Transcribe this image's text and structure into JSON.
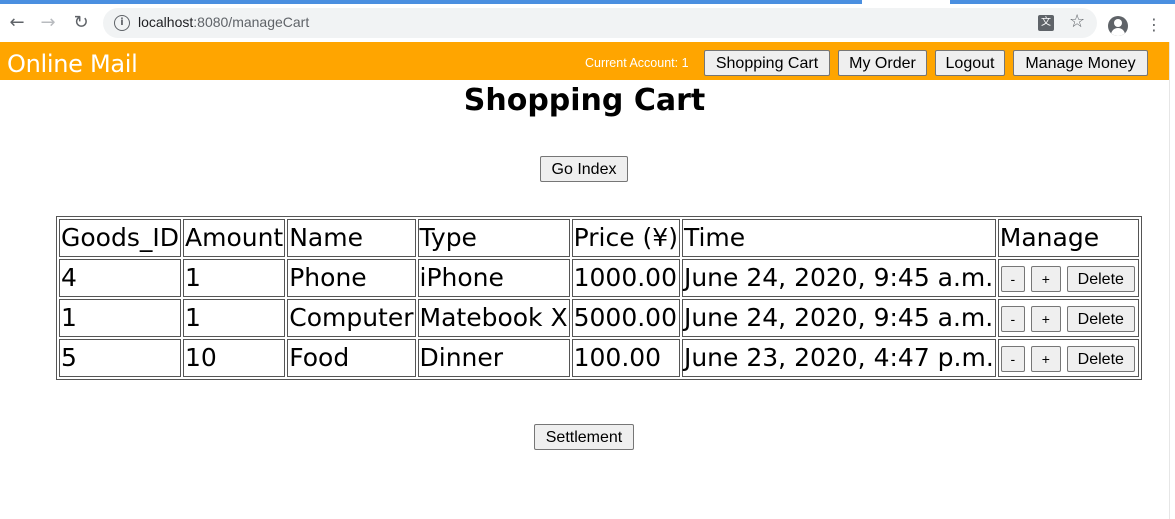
{
  "browser": {
    "url_host": "localhost",
    "url_path": ":8080/manageCart"
  },
  "header": {
    "site_title": "Online Mail",
    "account_text": "Current Account: 1",
    "nav_buttons": [
      "Shopping Cart",
      "My Order",
      "Logout",
      "Manage Money"
    ]
  },
  "main": {
    "page_title": "Shopping Cart",
    "go_index_label": "Go Index",
    "settlement_label": "Settlement",
    "table": {
      "headers": [
        "Goods_ID",
        "Amount",
        "Name",
        "Type",
        "Price (¥)",
        "Time",
        "Manage"
      ],
      "rows": [
        {
          "goods_id": "4",
          "amount": "1",
          "name": "Phone",
          "type": "iPhone",
          "price": "1000.00",
          "time": "June 24, 2020, 9:45 a.m."
        },
        {
          "goods_id": "1",
          "amount": "1",
          "name": "Computer",
          "type": "Matebook X",
          "price": "5000.00",
          "time": "June 24, 2020, 9:45 a.m."
        },
        {
          "goods_id": "5",
          "amount": "10",
          "name": "Food",
          "type": "Dinner",
          "price": "100.00",
          "time": "June 23, 2020, 4:47 p.m."
        }
      ],
      "manage_buttons": {
        "decrease": "-",
        "increase": "+",
        "delete": "Delete"
      }
    }
  },
  "colors": {
    "header_bg": "#ffa500",
    "header_text": "#ffffff",
    "tab_strip": "#4a8fe0"
  },
  "icons": [
    "back-arrow-icon",
    "forward-arrow-icon",
    "reload-icon",
    "info-icon",
    "translate-icon",
    "star-icon",
    "profile-icon",
    "menu-icon"
  ]
}
